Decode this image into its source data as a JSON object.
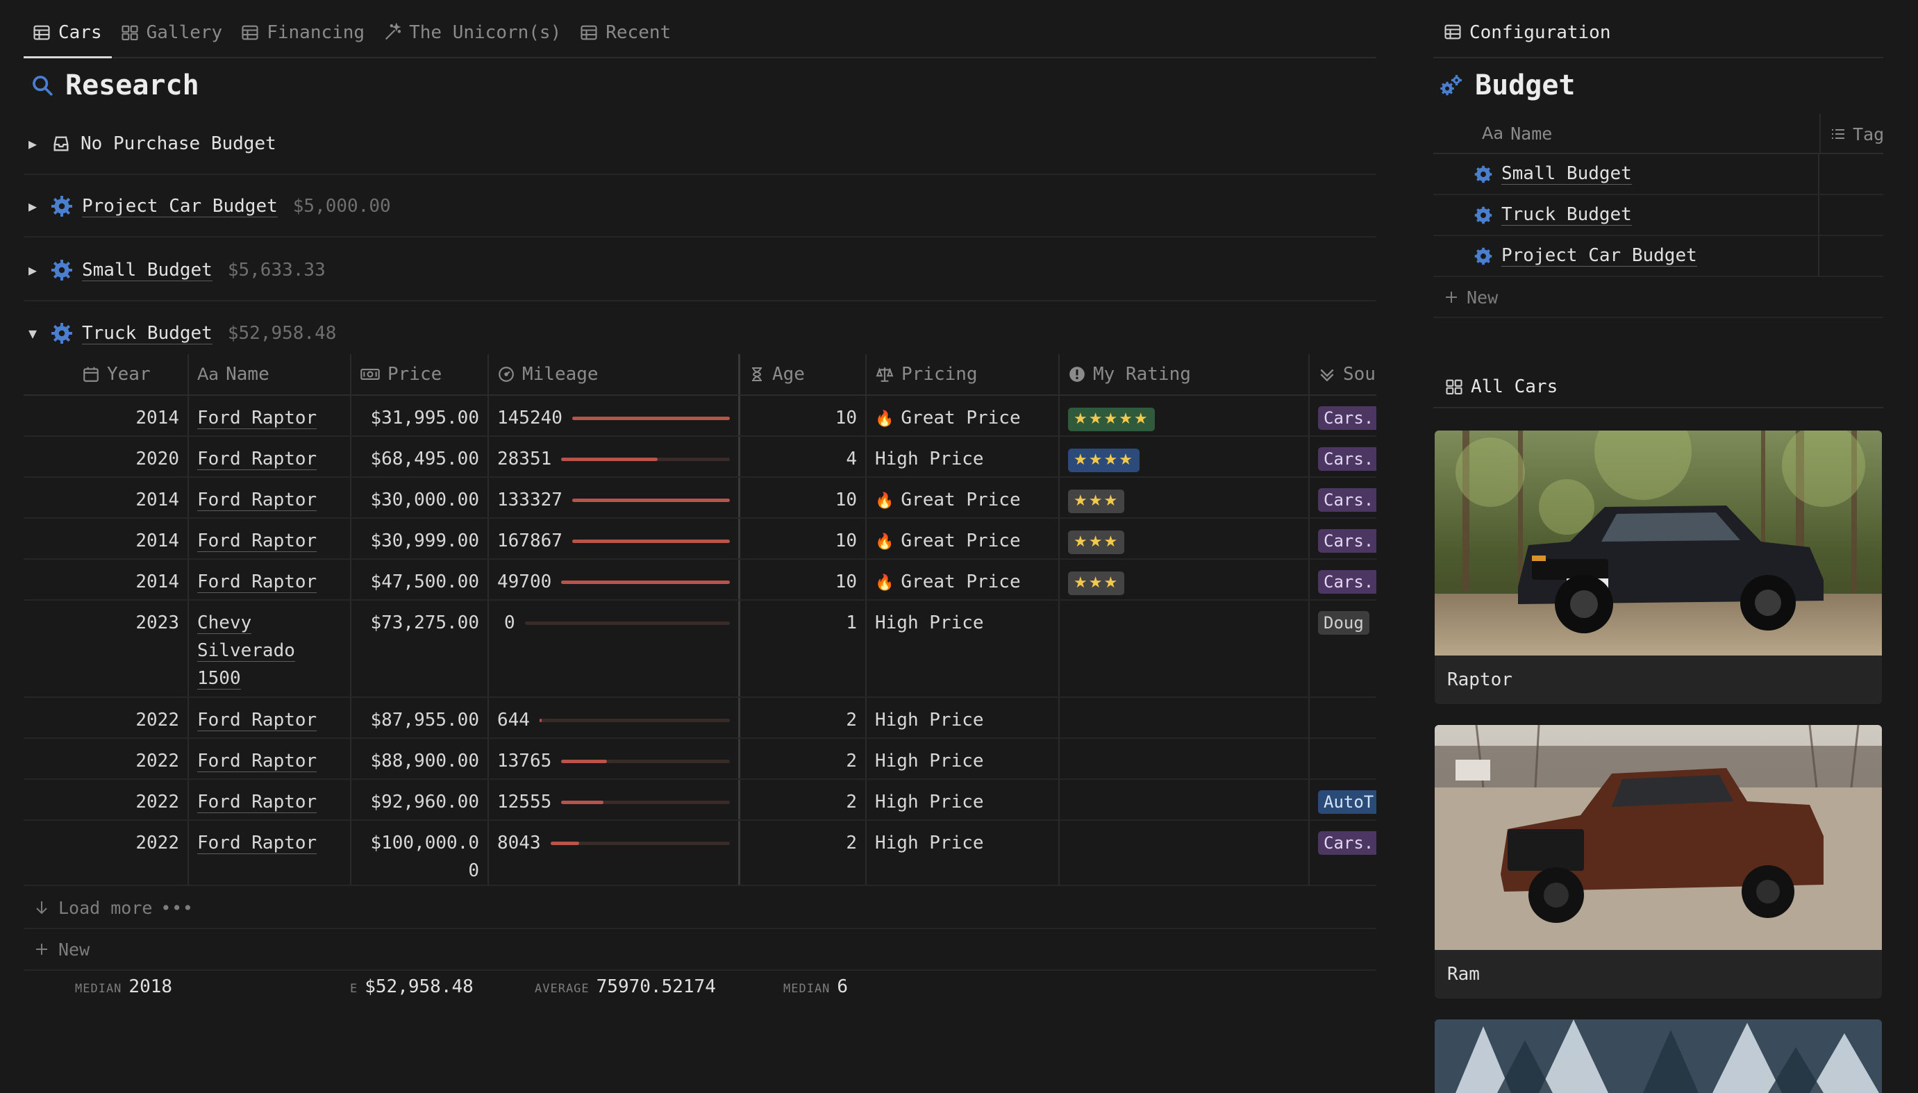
{
  "tabs": [
    {
      "label": "Cars",
      "icon": "table-icon",
      "active": true
    },
    {
      "label": "Gallery",
      "icon": "gallery-icon"
    },
    {
      "label": "Financing",
      "icon": "table-icon"
    },
    {
      "label": "The Unicorn(s)",
      "icon": "magic-wand-icon"
    },
    {
      "label": "Recent",
      "icon": "table-icon"
    }
  ],
  "page_title": "Research",
  "groups": [
    {
      "name": "No Purchase Budget",
      "value": ""
    },
    {
      "name": "Project Car Budget",
      "value": "$5,000.00"
    },
    {
      "name": "Small Budget",
      "value": "$5,633.33"
    },
    {
      "name": "Truck Budget",
      "value": "$52,958.48"
    }
  ],
  "columns": {
    "year": "Year",
    "name": "Name",
    "name_prefix": "Aa",
    "price": "Price",
    "mileage": "Mileage",
    "age": "Age",
    "pricing": "Pricing",
    "rating": "My Rating",
    "source": "Sou"
  },
  "rows": [
    {
      "year": "2014",
      "name": "Ford Raptor",
      "price": "$31,995.00",
      "mileage": "145240",
      "mileage_fraction": 1.0,
      "age": "10",
      "pricing": "Great Price",
      "great": true,
      "rating": "★★★★★",
      "stars": 5,
      "source": "Cars.",
      "source_color": "purple"
    },
    {
      "year": "2020",
      "name": "Ford Raptor",
      "price": "$68,495.00",
      "mileage": "28351",
      "mileage_fraction": 0.57,
      "age": "4",
      "pricing": "High Price",
      "great": false,
      "rating": "★★★★",
      "stars": 4,
      "source": "Cars.",
      "source_color": "purple"
    },
    {
      "year": "2014",
      "name": "Ford Raptor",
      "price": "$30,000.00",
      "mileage": "133327",
      "mileage_fraction": 1.0,
      "age": "10",
      "pricing": "Great Price",
      "great": true,
      "rating": "★★★",
      "stars": 3,
      "source": "Cars.",
      "source_color": "purple"
    },
    {
      "year": "2014",
      "name": "Ford Raptor",
      "price": "$30,999.00",
      "mileage": "167867",
      "mileage_fraction": 1.0,
      "age": "10",
      "pricing": "Great Price",
      "great": true,
      "rating": "★★★",
      "stars": 3,
      "source": "Cars.",
      "source_color": "purple"
    },
    {
      "year": "2014",
      "name": "Ford Raptor",
      "price": "$47,500.00",
      "mileage": "49700",
      "mileage_fraction": 1.0,
      "age": "10",
      "pricing": "Great Price",
      "great": true,
      "rating": "★★★",
      "stars": 3,
      "source": "Cars.",
      "source_color": "purple"
    },
    {
      "year": "2023",
      "name": "Chevy Silverado 1500",
      "price": "$73,275.00",
      "mileage": "0",
      "mileage_fraction": 0.0,
      "age": "1",
      "pricing": "High Price",
      "great": false,
      "rating": "",
      "stars": 0,
      "source": "Doug",
      "source_color": "gray"
    },
    {
      "year": "2022",
      "name": "Ford Raptor",
      "price": "$87,955.00",
      "mileage": "644",
      "mileage_fraction": 0.01,
      "age": "2",
      "pricing": "High Price",
      "great": false,
      "rating": "",
      "stars": 0,
      "source": "",
      "source_color": ""
    },
    {
      "year": "2022",
      "name": "Ford Raptor",
      "price": "$88,900.00",
      "mileage": "13765",
      "mileage_fraction": 0.27,
      "age": "2",
      "pricing": "High Price",
      "great": false,
      "rating": "",
      "stars": 0,
      "source": "",
      "source_color": ""
    },
    {
      "year": "2022",
      "name": "Ford Raptor",
      "price": "$92,960.00",
      "mileage": "12555",
      "mileage_fraction": 0.25,
      "age": "2",
      "pricing": "High Price",
      "great": false,
      "rating": "",
      "stars": 0,
      "source": "AutoT",
      "source_color": "blue"
    },
    {
      "year": "2022",
      "name": "Ford Raptor",
      "price": "$100,000.00",
      "mileage": "8043",
      "mileage_fraction": 0.16,
      "age": "2",
      "pricing": "High Price",
      "great": false,
      "rating": "",
      "stars": 0,
      "source": "Cars.",
      "source_color": "purple"
    }
  ],
  "load_more": "Load more",
  "new_label": "New",
  "aggregates": {
    "year_label": "MEDIAN",
    "year_value": "2018",
    "price_label": "E",
    "price_value": "$52,958.48",
    "mileage_label": "AVERAGE",
    "mileage_value": "75970.52174",
    "age_label": "MEDIAN",
    "age_value": "6"
  },
  "right": {
    "config_tab": "Configuration",
    "title": "Budget",
    "name_prefix": "Aa",
    "name_header": "Name",
    "tags_header": "Tag",
    "items": [
      "Small Budget",
      "Truck Budget",
      "Project Car Budget"
    ],
    "new_label": "New",
    "all_cars": "All Cars",
    "cards": [
      "Raptor",
      "Ram"
    ]
  },
  "colors": {
    "accent_blue": "#4a7fd0",
    "bar_fill": "#b9544a",
    "rating5": "#2f5a3c",
    "rating4": "#2c4a7a",
    "source_purple": "#4b3762"
  }
}
